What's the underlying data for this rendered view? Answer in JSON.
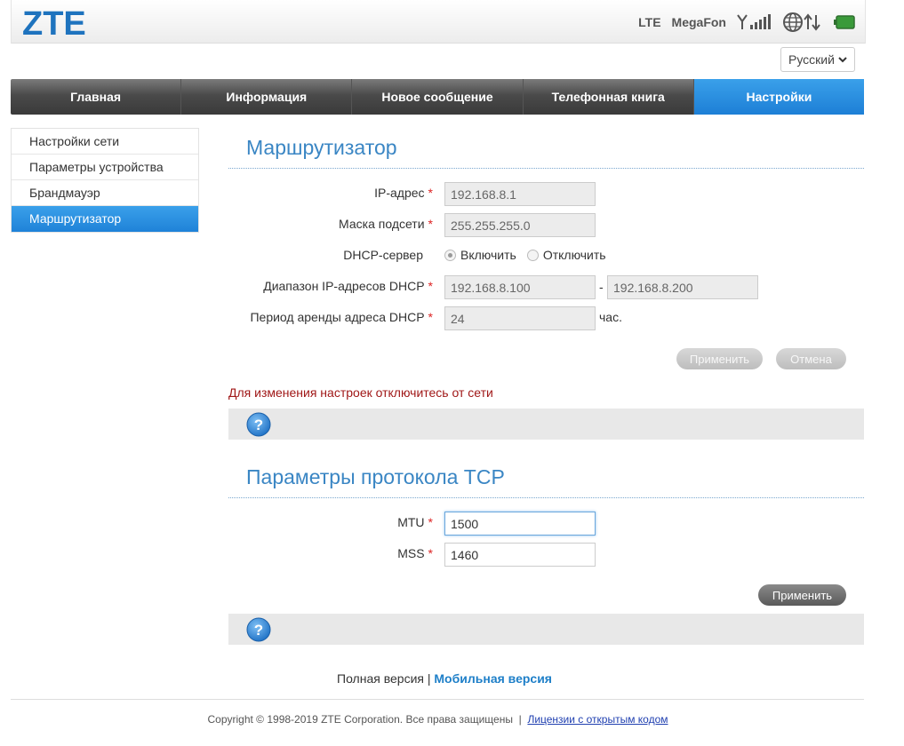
{
  "header": {
    "logo": "ZTE",
    "network_type": "LTE",
    "operator": "MegaFon",
    "icons": [
      "signal-icon",
      "internet-connected-icon",
      "battery-icon"
    ]
  },
  "language": {
    "selected": "Русский"
  },
  "nav": {
    "items": [
      "Главная",
      "Информация",
      "Новое сообщение",
      "Телефонная книга",
      "Настройки"
    ],
    "active": "Настройки"
  },
  "sidebar": {
    "items": [
      "Настройки сети",
      "Параметры устройства",
      "Брандмауэр",
      "Маршрутизатор"
    ],
    "active": "Маршрутизатор"
  },
  "router": {
    "title": "Маршрутизатор",
    "ip_label": "IP-адрес",
    "ip_value": "192.168.8.1",
    "mask_label": "Маска подсети",
    "mask_value": "255.255.255.0",
    "dhcp_label": "DHCP-сервер",
    "dhcp_on": "Включить",
    "dhcp_off": "Отключить",
    "range_label": "Диапазон IP-адресов DHCP",
    "range_start": "192.168.8.100",
    "range_sep": "-",
    "range_end": "192.168.8.200",
    "lease_label": "Период аренды адреса DHCP",
    "lease_value": "24",
    "lease_unit": "час.",
    "apply": "Применить",
    "cancel": "Отмена",
    "warning": "Для изменения настроек отключитесь от сети",
    "required_mark": "*"
  },
  "tcp": {
    "title": "Параметры протокола TCP",
    "mtu_label": "MTU",
    "mtu_value": "1500",
    "mss_label": "MSS",
    "mss_value": "1460",
    "apply": "Применить"
  },
  "footer": {
    "full_version": "Полная версия",
    "separator": "|",
    "mobile_version": "Мобильная версия",
    "copyright": "Copyright © 1998-2019 ZTE Corporation. Все права защищены",
    "copyright_sep": "|",
    "license_link": "Лицензии с открытым кодом"
  },
  "colors": {
    "accent": "#1e7fd6",
    "title": "#3a86c4",
    "warning": "#a01818"
  }
}
